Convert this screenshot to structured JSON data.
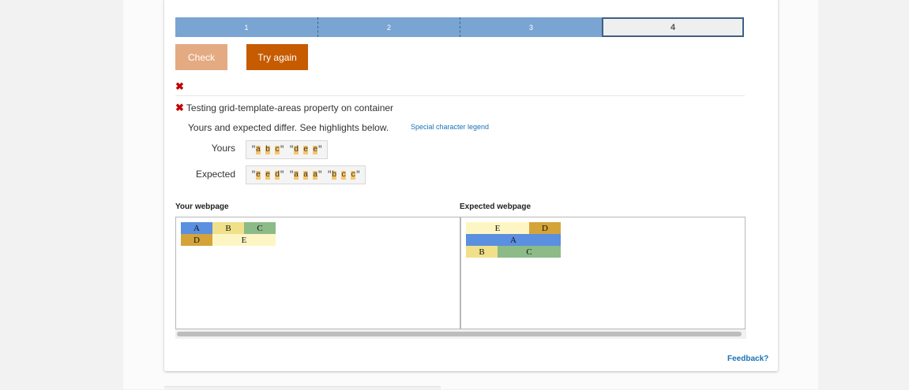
{
  "progress": {
    "steps": [
      "1",
      "2",
      "3",
      "4"
    ],
    "current_index": 3
  },
  "buttons": {
    "check": "Check",
    "try_again": "Try again"
  },
  "result": {
    "cross_icon": "✖",
    "test_title": "Testing grid-template-areas property on container",
    "differ_text": "Yours and expected differ. See highlights below.",
    "legend_link": "Special character legend"
  },
  "comparison": {
    "yours_label": "Yours",
    "expected_label": "Expected",
    "yours_value": "\"a b c\" \"d e e\"",
    "expected_value": "\"e e d\" \"a a a\" \"b c c\""
  },
  "panes": {
    "your_title": "Your webpage",
    "expected_title": "Expected webpage",
    "your_areas": [
      {
        "label": "A",
        "row": 1,
        "col": 1,
        "span": 1,
        "color": "#5b8fe0"
      },
      {
        "label": "B",
        "row": 1,
        "col": 2,
        "span": 1,
        "color": "#f0e08a"
      },
      {
        "label": "C",
        "row": 1,
        "col": 3,
        "span": 1,
        "color": "#8cbb88"
      },
      {
        "label": "D",
        "row": 2,
        "col": 1,
        "span": 1,
        "color": "#d4a43a"
      },
      {
        "label": "E",
        "row": 2,
        "col": 2,
        "span": 2,
        "color": "#fdf6c4"
      }
    ],
    "expected_areas": [
      {
        "label": "E",
        "row": 1,
        "col": 1,
        "span": 2,
        "color": "#fdf6c4"
      },
      {
        "label": "D",
        "row": 1,
        "col": 3,
        "span": 1,
        "color": "#d4a43a"
      },
      {
        "label": "A",
        "row": 2,
        "col": 1,
        "span": 3,
        "color": "#5b8fe0"
      },
      {
        "label": "B",
        "row": 3,
        "col": 1,
        "span": 1,
        "color": "#f0e08a"
      },
      {
        "label": "C",
        "row": 3,
        "col": 2,
        "span": 2,
        "color": "#8cbb88"
      }
    ]
  },
  "footer": {
    "feedback": "Feedback?"
  },
  "colors": {
    "accent": "#c65b00",
    "link": "#1a73b8",
    "highlight": "#f6c66c",
    "progress": "#7aa5d2"
  }
}
